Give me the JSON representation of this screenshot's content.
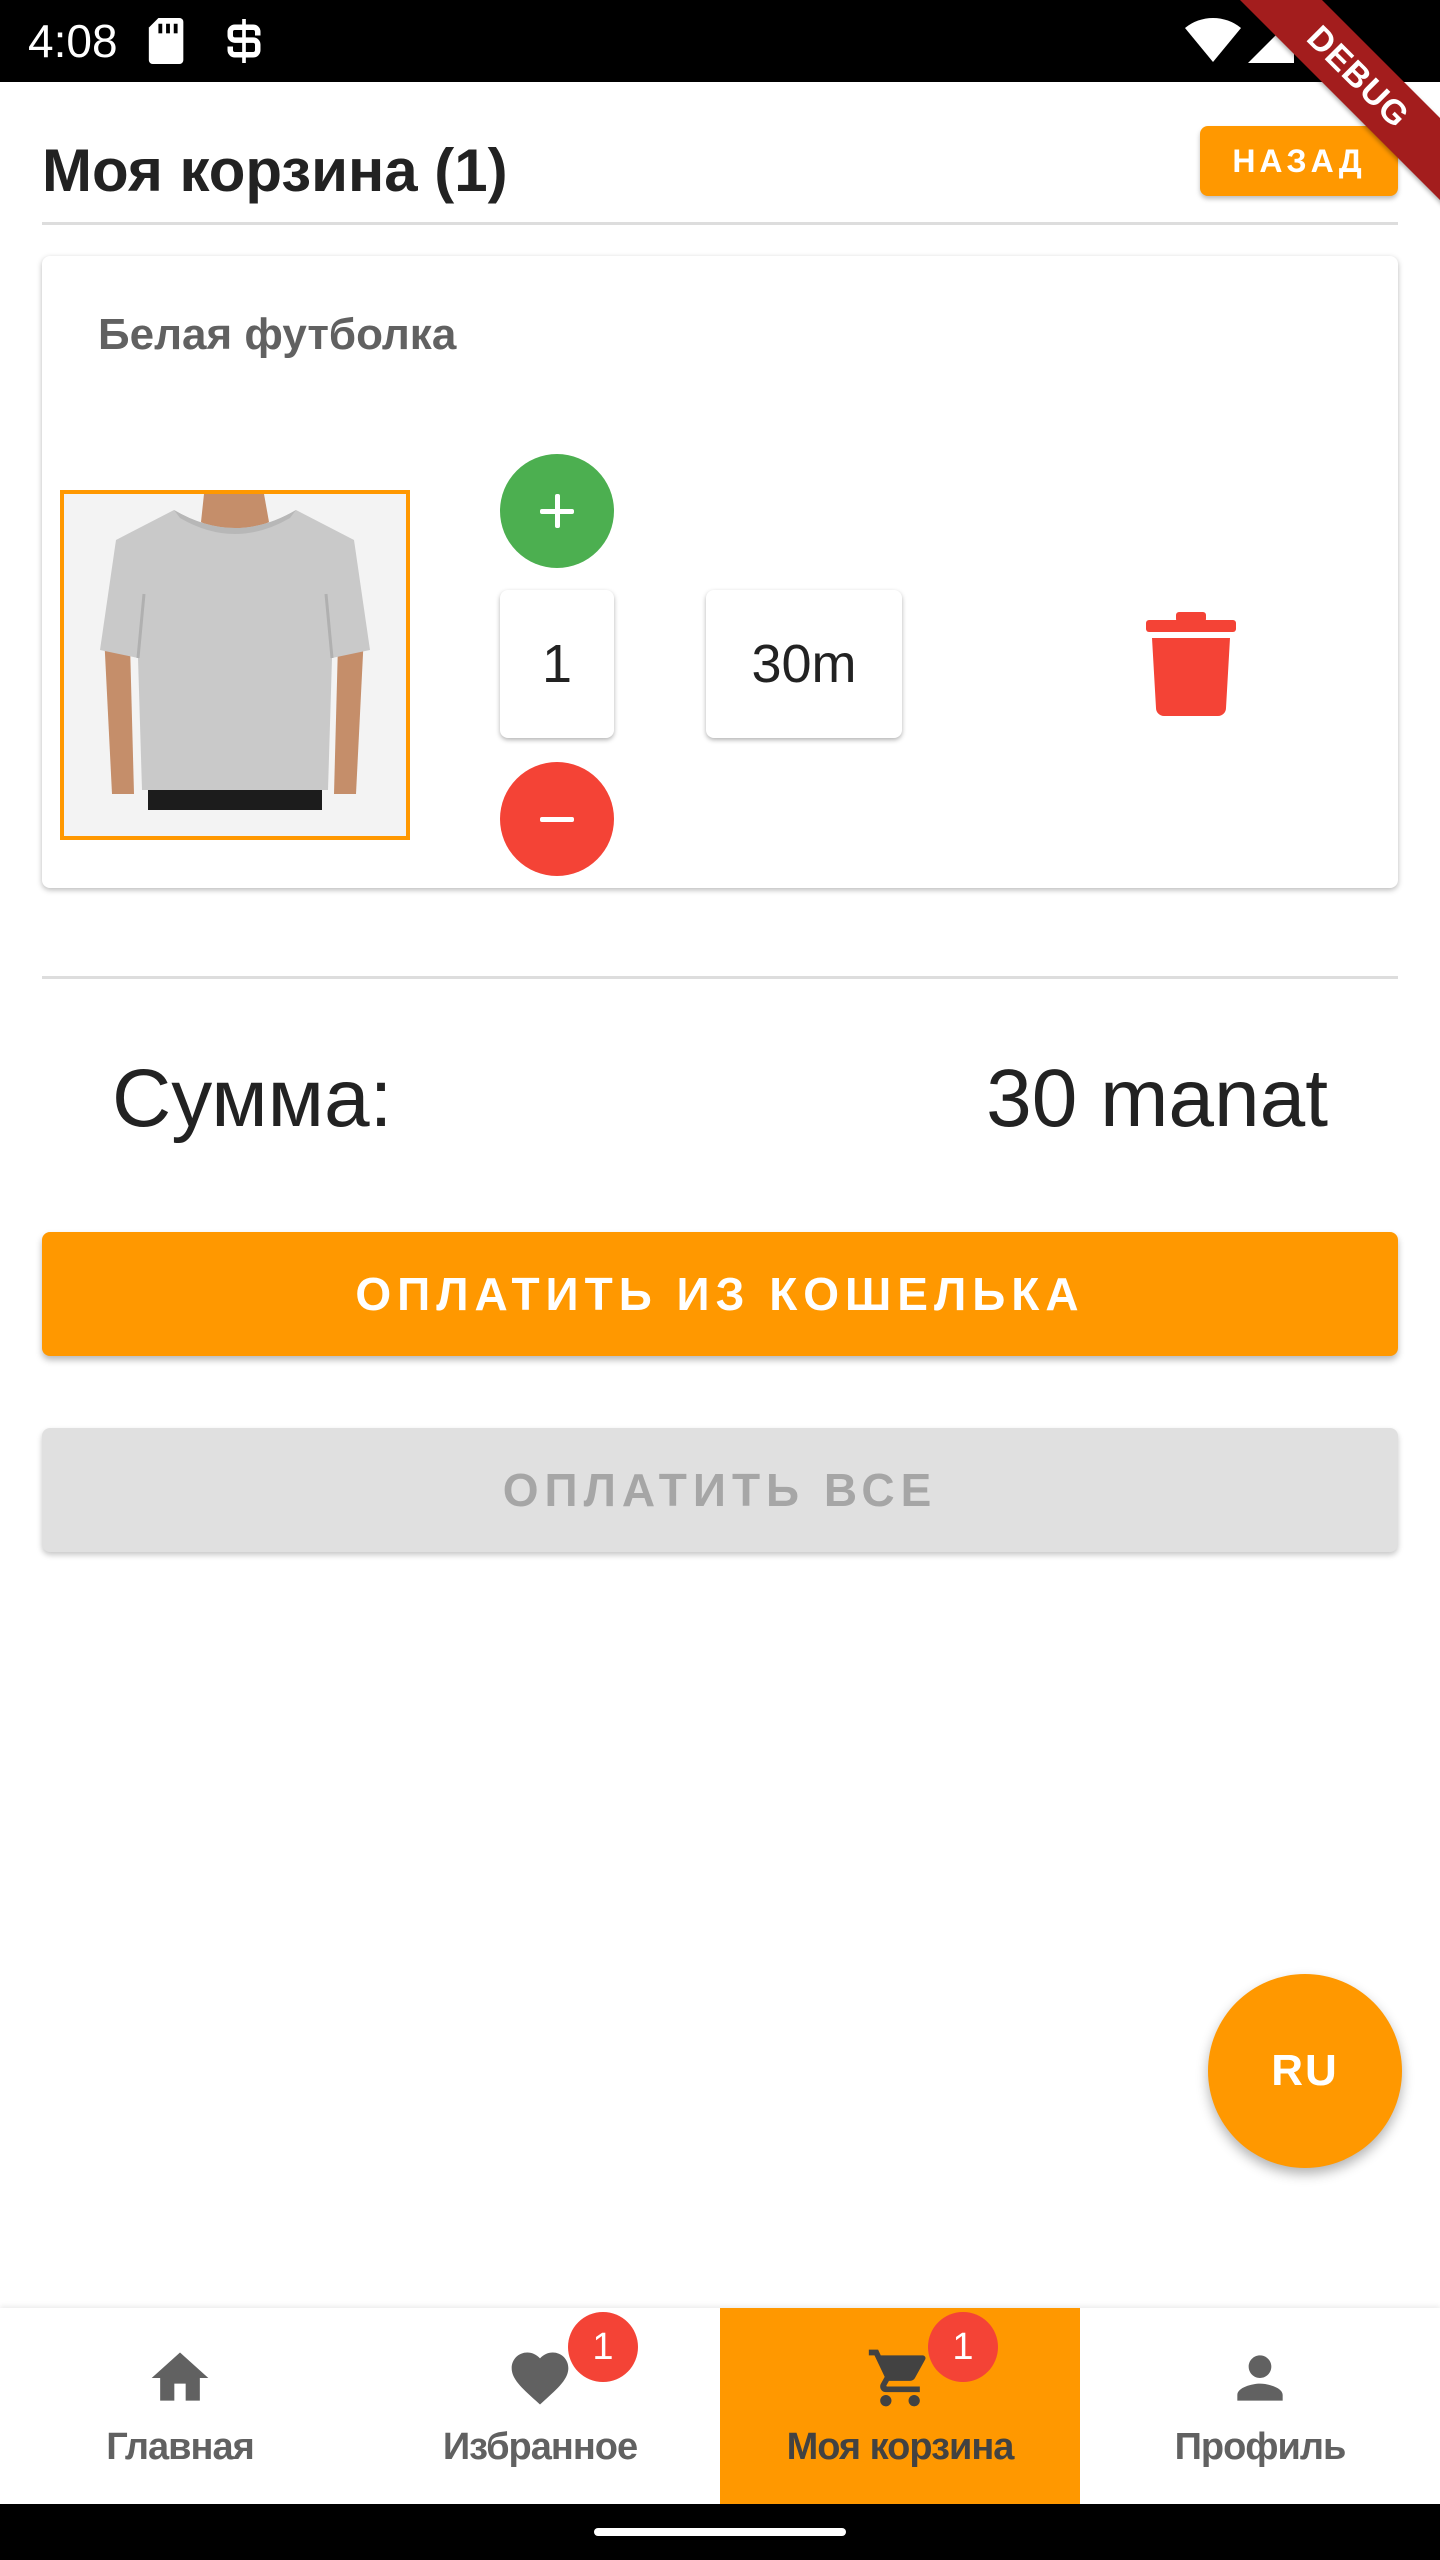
{
  "status_bar": {
    "time": "4:08",
    "icons": [
      "sd-card-icon",
      "vpn-icon",
      "wifi-icon",
      "signal-icon",
      "battery-icon"
    ]
  },
  "debug_banner": "DEBUG",
  "header": {
    "title": "Моя корзина (1)",
    "back_label": "НАЗАД"
  },
  "cart": {
    "items": [
      {
        "name": "Белая футболка",
        "image": "white-tshirt",
        "quantity": "1",
        "price": "30m"
      }
    ]
  },
  "summary": {
    "label": "Сумма:",
    "value": "30 manat"
  },
  "actions": {
    "pay_wallet": "ОПЛАТИТЬ ИЗ КОШЕЛЬКА",
    "pay_all": "ОПЛАТИТЬ ВСЕ"
  },
  "language_fab": "RU",
  "bottom_nav": {
    "items": [
      {
        "label": "Главная",
        "icon": "home-icon"
      },
      {
        "label": "Избранное",
        "icon": "heart-icon",
        "badge": "1"
      },
      {
        "label": "Моя корзина",
        "icon": "cart-icon",
        "badge": "1",
        "active": true
      },
      {
        "label": "Профиль",
        "icon": "person-icon"
      }
    ]
  },
  "colors": {
    "accent": "#ff9800",
    "plus": "#4caf50",
    "minus": "#f44336",
    "delete": "#f44336",
    "badge": "#f44336",
    "disabled_button": "#e0e0e0"
  }
}
